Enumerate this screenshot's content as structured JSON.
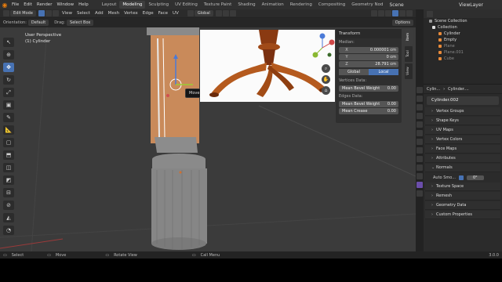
{
  "topbar": {
    "menus": [
      "File",
      "Edit",
      "Render",
      "Window",
      "Help"
    ],
    "workspaces": [
      "Layout",
      "Modeling",
      "Sculpting",
      "UV Editing",
      "Texture Paint",
      "Shading",
      "Animation",
      "Rendering",
      "Compositing",
      "Geometry Nod"
    ],
    "active_workspace": "Modeling",
    "scene": "Scene",
    "view_layer": "ViewLayer"
  },
  "header": {
    "mode": "Edit Mode",
    "menus": [
      "View",
      "Select",
      "Add",
      "Mesh",
      "Vertex",
      "Edge",
      "Face",
      "UV"
    ],
    "transform_orientation": "Global",
    "orientation_label": "Orientation:",
    "orientation_value": "Default",
    "drag_label": "Drag:",
    "drag_value": "Select Box",
    "options": "Options"
  },
  "viewport": {
    "view_name": "User Perspective",
    "object_name": "(1) Cylinder",
    "tooltip": "Move selected items"
  },
  "npanel": {
    "title": "Transform",
    "median_label": "Median:",
    "x_key": "X",
    "x_value": "0.000001 cm",
    "y_key": "Y",
    "y_value": "0 cm",
    "z_key": "Z",
    "z_value": "28.791 cm",
    "global_label": "Global",
    "local_label": "Local",
    "vertices_data_label": "Vertices Data:",
    "vertex_bevel_label": "Mean Bevel Weight",
    "vertex_bevel_value": "0.00",
    "edges_data_label": "Edges Data:",
    "edge_bevel_label": "Mean Bevel Weight",
    "edge_bevel_value": "0.00",
    "crease_label": "Mean Crease",
    "crease_value": "0.00",
    "tabs": [
      "Item",
      "Tool",
      "View"
    ]
  },
  "outliner": {
    "title": "Scene Collection",
    "items": [
      {
        "label": "Collection"
      },
      {
        "label": "Cylinder"
      },
      {
        "label": "Empty"
      },
      {
        "label": "Plane"
      },
      {
        "label": "Plane.001"
      },
      {
        "label": "Cube"
      }
    ]
  },
  "properties": {
    "crumb_a": "Cylin...",
    "crumb_b": "Cylinder....",
    "mesh_name": "Cylinder.002",
    "sections": [
      "Vertex Groups",
      "Shape Keys",
      "UV Maps",
      "Vertex Colors",
      "Face Maps",
      "Attributes"
    ],
    "normals": "Normals",
    "auto_smooth": "Auto Smo...",
    "auto_smooth_angle": "0°",
    "sections2": [
      "Texture Space",
      "Remesh",
      "Geometry Data",
      "Custom Properties"
    ]
  },
  "statusbar": {
    "select": "Select",
    "move": "Move",
    "rotate": "Rotate View",
    "menu": "Call Menu",
    "version": "3.0.0"
  }
}
